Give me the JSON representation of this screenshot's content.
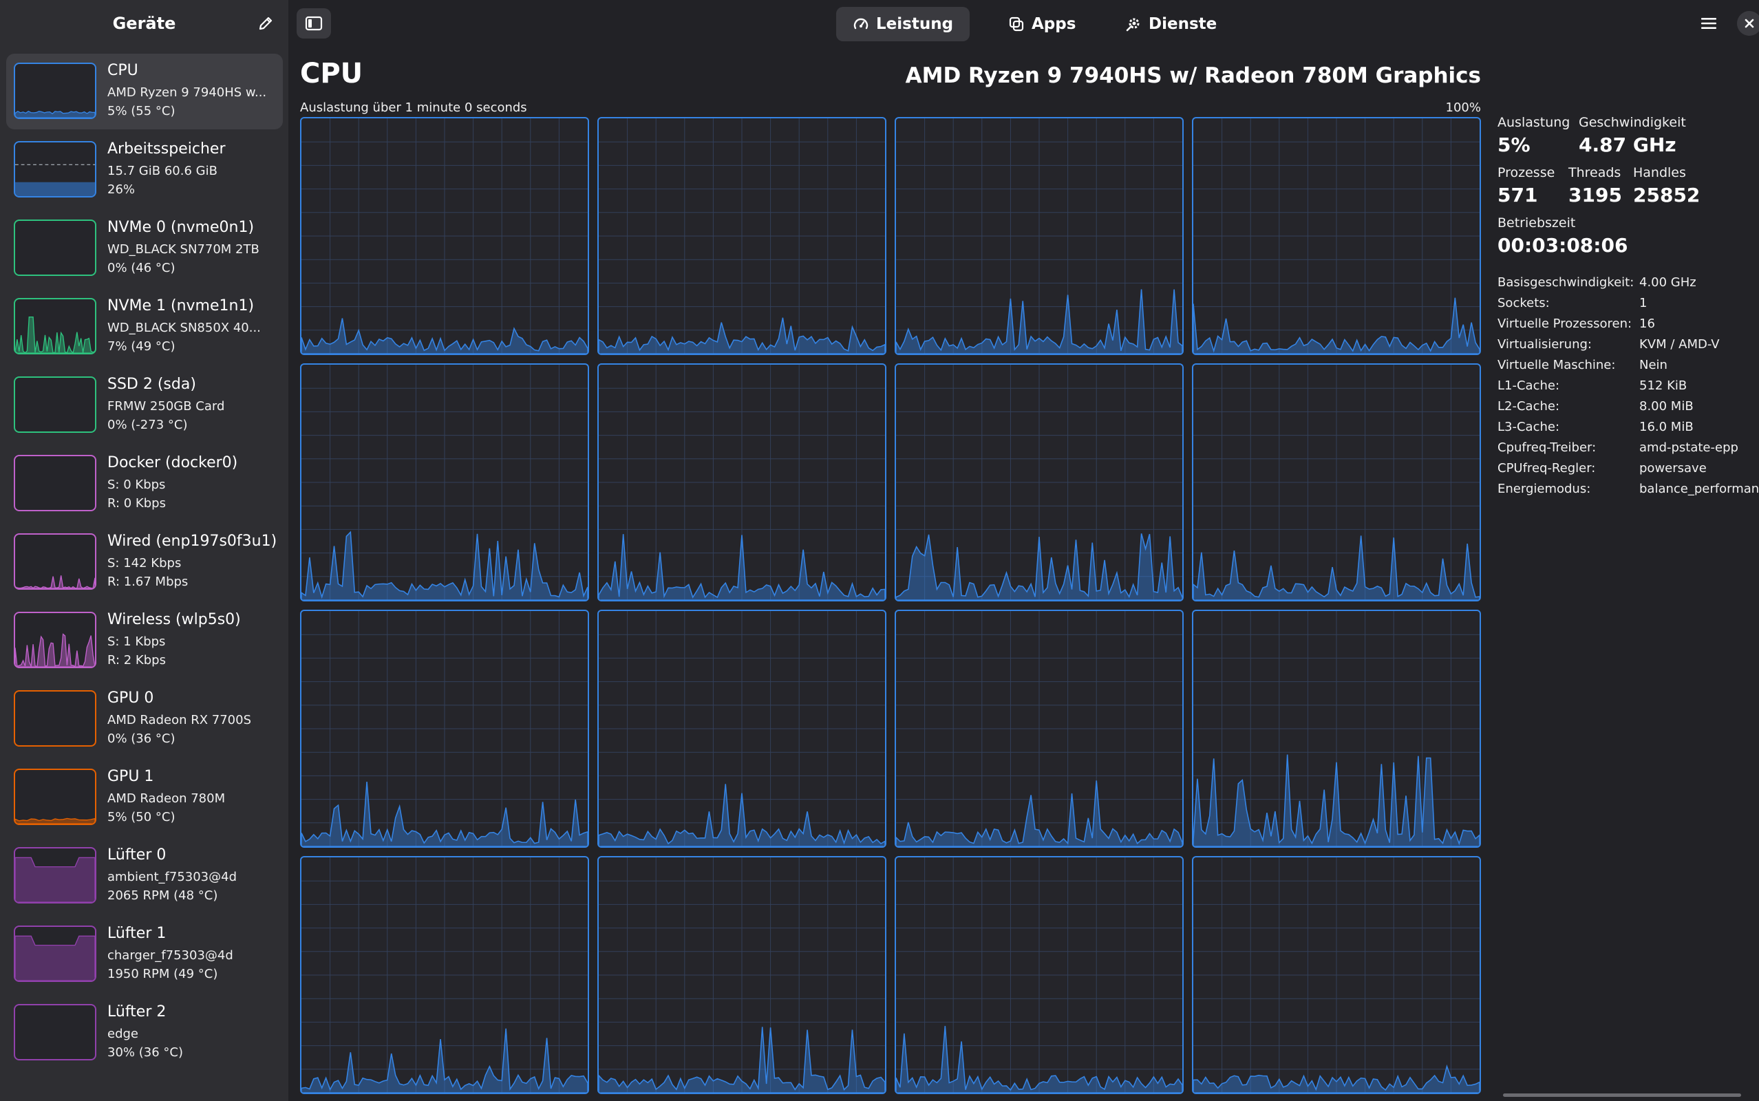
{
  "sidebar": {
    "title": "Geräte",
    "items": [
      {
        "name": "CPU",
        "line1": "AMD Ryzen 9 7940HS w...",
        "line2": "5% (55 °C)",
        "color": "#3584e4",
        "selected": true,
        "kind": "area",
        "icon": "cpu-graph"
      },
      {
        "name": "Arbeitsspeicher",
        "line1": "15.7 GiB 60.6 GiB",
        "line2": "26%",
        "color": "#3584e4",
        "kind": "memory",
        "fill": 0.26,
        "icon": "memory-graph"
      },
      {
        "name": "NVMe 0 (nvme0n1)",
        "line1": "WD_BLACK SN770M 2TB",
        "line2": "0% (46 °C)",
        "color": "#2ec27e",
        "kind": "empty",
        "icon": "disk-graph"
      },
      {
        "name": "NVMe 1 (nvme1n1)",
        "line1": "WD_BLACK SN850X 40...",
        "line2": "7% (49 °C)",
        "color": "#2ec27e",
        "kind": "spikes",
        "icon": "disk-graph"
      },
      {
        "name": "SSD 2 (sda)",
        "line1": "FRMW 250GB Card",
        "line2": "0% (-273 °C)",
        "color": "#2ec27e",
        "kind": "empty",
        "icon": "disk-graph"
      },
      {
        "name": "Docker (docker0)",
        "line1": "S: 0 Kbps",
        "line2": "R: 0 Kbps",
        "color": "#c061cb",
        "kind": "empty",
        "icon": "network-graph"
      },
      {
        "name": "Wired (enp197s0f3u1)",
        "line1": "S: 142 Kbps",
        "line2": "R: 1.67 Mbps",
        "color": "#c061cb",
        "kind": "net-small",
        "icon": "network-graph"
      },
      {
        "name": "Wireless (wlp5s0)",
        "line1": "S: 1 Kbps",
        "line2": "R: 2 Kbps",
        "color": "#c061cb",
        "kind": "net-big",
        "icon": "network-graph"
      },
      {
        "name": "GPU 0",
        "line1": "AMD Radeon RX 7700S",
        "line2": "0% (36 °C)",
        "color": "#e66100",
        "kind": "empty",
        "icon": "gpu-graph"
      },
      {
        "name": "GPU 1",
        "line1": "AMD Radeon 780M",
        "line2": "5% (50 °C)",
        "color": "#e66100",
        "kind": "flat",
        "icon": "gpu-graph"
      },
      {
        "name": "Lüfter 0",
        "line1": "ambient_f75303@4d",
        "line2": "2065 RPM (48 °C)",
        "color": "#9141ac",
        "kind": "fan",
        "icon": "fan-graph"
      },
      {
        "name": "Lüfter 1",
        "line1": "charger_f75303@4d",
        "line2": "1950 RPM (49 °C)",
        "color": "#9141ac",
        "kind": "fan",
        "icon": "fan-graph"
      },
      {
        "name": "Lüfter 2",
        "line1": "edge",
        "line2": "30% (36 °C)",
        "color": "#9141ac",
        "kind": "empty",
        "icon": "fan-graph"
      }
    ]
  },
  "header": {
    "tabs": [
      {
        "label": "Leistung",
        "icon": "gauge-icon",
        "active": true
      },
      {
        "label": "Apps",
        "icon": "apps-icon",
        "active": false
      },
      {
        "label": "Dienste",
        "icon": "gear-icon",
        "active": false
      }
    ]
  },
  "main": {
    "title": "CPU",
    "model": "AMD Ryzen 9 7940HS w/ Radeon 780M Graphics",
    "graph_caption": "Auslastung über 1 minute 0 seconds",
    "graph_max": "100%",
    "core_count": 16,
    "accent": "#3584e4"
  },
  "details": {
    "utilization_label": "Auslastung",
    "utilization": "5%",
    "speed_label": "Geschwindigkeit",
    "speed": "4.87 GHz",
    "processes_label": "Prozesse",
    "processes": "571",
    "threads_label": "Threads",
    "threads": "3195",
    "handles_label": "Handles",
    "handles": "25852",
    "uptime_label": "Betriebszeit",
    "uptime": "00:03:08:06",
    "info": [
      {
        "key": "Basisgeschwindigkeit:",
        "value": "4.00 GHz"
      },
      {
        "key": "Sockets:",
        "value": "1"
      },
      {
        "key": "Virtuelle Prozessoren:",
        "value": "16"
      },
      {
        "key": "Virtualisierung:",
        "value": "KVM / AMD-V"
      },
      {
        "key": "Virtuelle Maschine:",
        "value": "Nein"
      },
      {
        "key": "L1-Cache:",
        "value": "512 KiB"
      },
      {
        "key": "L2-Cache:",
        "value": "8.00 MiB"
      },
      {
        "key": "L3-Cache:",
        "value": "16.0 MiB"
      },
      {
        "key": "Cpufreq-Treiber:",
        "value": "amd-pstate-epp"
      },
      {
        "key": "CPUfreq-Regler:",
        "value": "powersave"
      },
      {
        "key": "Energiemodus:",
        "value": "balance_performance"
      }
    ]
  }
}
